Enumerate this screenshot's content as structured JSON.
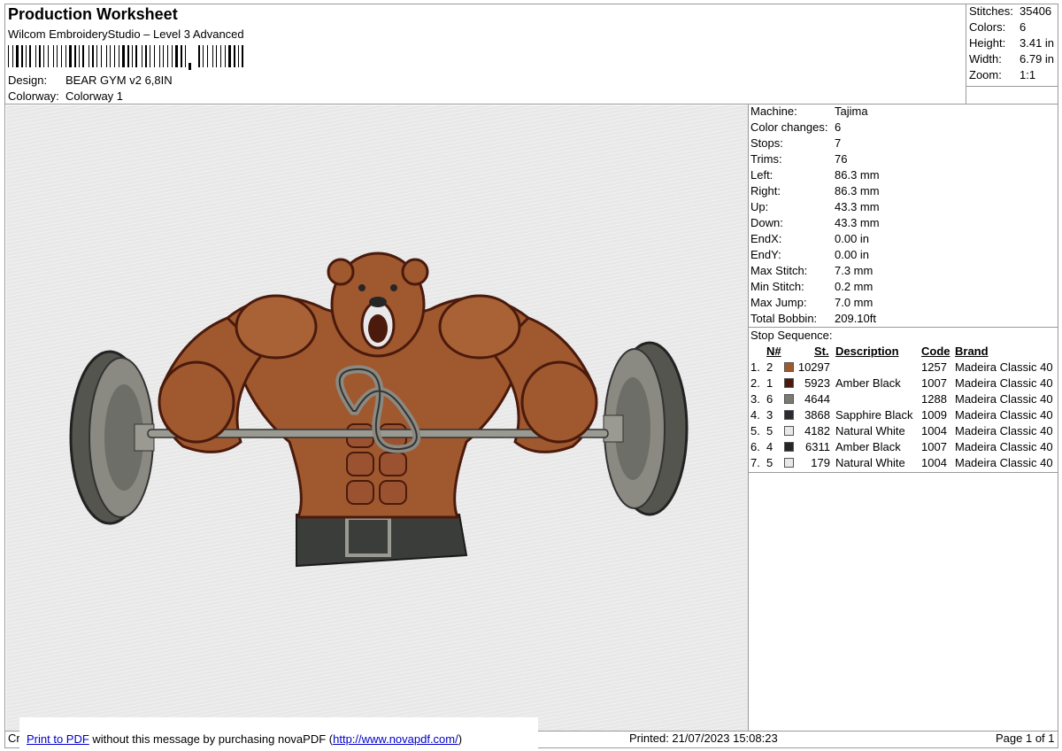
{
  "header": {
    "title": "Production Worksheet",
    "software": "Wilcom EmbroideryStudio – Level 3 Advanced",
    "design_label": "Design:",
    "design_value": "BEAR GYM v2 6,8IN",
    "colorway_label": "Colorway:",
    "colorway_value": "Colorway 1"
  },
  "summary": [
    {
      "label": "Stitches:",
      "value": "35406"
    },
    {
      "label": "Colors:",
      "value": "6"
    },
    {
      "label": "Height:",
      "value": "3.41 in"
    },
    {
      "label": "Width:",
      "value": "6.79 in"
    },
    {
      "label": "Zoom:",
      "value": "1:1"
    }
  ],
  "machine_info": [
    {
      "label": "Machine:",
      "value": "Tajima"
    },
    {
      "label": "Color changes:",
      "value": "6"
    },
    {
      "label": "Stops:",
      "value": "7"
    },
    {
      "label": "Trims:",
      "value": "76"
    },
    {
      "label": "Left:",
      "value": "86.3 mm"
    },
    {
      "label": "Right:",
      "value": "86.3 mm"
    },
    {
      "label": "Up:",
      "value": "43.3 mm"
    },
    {
      "label": "Down:",
      "value": "43.3 mm"
    },
    {
      "label": "EndX:",
      "value": "0.00 in"
    },
    {
      "label": "EndY:",
      "value": "0.00 in"
    },
    {
      "label": "Max Stitch:",
      "value": "7.3 mm"
    },
    {
      "label": "Min Stitch:",
      "value": "0.2 mm"
    },
    {
      "label": "Max Jump:",
      "value": "7.0 mm"
    },
    {
      "label": "Total Bobbin:",
      "value": "209.10ft"
    }
  ],
  "stop_sequence": {
    "title": "Stop Sequence:",
    "headers": {
      "n": "N#",
      "st": "St.",
      "desc": "Description",
      "code": "Code",
      "brand": "Brand"
    },
    "rows": [
      {
        "idx": "1.",
        "n": "2",
        "color": "#a0582f",
        "st": "10297",
        "desc": "",
        "code": "1257",
        "brand": "Madeira Classic 40"
      },
      {
        "idx": "2.",
        "n": "1",
        "color": "#4a1a0c",
        "st": "5923",
        "desc": "Amber Black",
        "code": "1007",
        "brand": "Madeira Classic 40"
      },
      {
        "idx": "3.",
        "n": "6",
        "color": "#7a7a72",
        "st": "4644",
        "desc": "",
        "code": "1288",
        "brand": "Madeira Classic 40"
      },
      {
        "idx": "4.",
        "n": "3",
        "color": "#2c2c30",
        "st": "3868",
        "desc": "Sapphire Black",
        "code": "1009",
        "brand": "Madeira Classic 40"
      },
      {
        "idx": "5.",
        "n": "5",
        "color": "#e8e8ea",
        "st": "4182",
        "desc": "Natural White",
        "code": "1004",
        "brand": "Madeira Classic 40"
      },
      {
        "idx": "6.",
        "n": "4",
        "color": "#262626",
        "st": "6311",
        "desc": "Amber Black",
        "code": "1007",
        "brand": "Madeira Classic 40"
      },
      {
        "idx": "7.",
        "n": "5",
        "color": "#e8e8ea",
        "st": "179",
        "desc": "Natural White",
        "code": "1004",
        "brand": "Madeira Classic 40"
      }
    ]
  },
  "footer": {
    "left_fragment": "Cr",
    "print_link": "Print to PDF",
    "message": " without this message by purchasing novaPDF (",
    "url": "http://www.novapdf.com/",
    "close_paren": ")",
    "printed": "Printed: 21/07/2023 15:08:23",
    "page": "Page 1 of 1"
  },
  "colors": {
    "fur": "#a0582f",
    "fur_dark": "#4a1a0c",
    "plate": "#6e6e68",
    "belt": "#3a3d3a",
    "link": "#0000cc"
  }
}
